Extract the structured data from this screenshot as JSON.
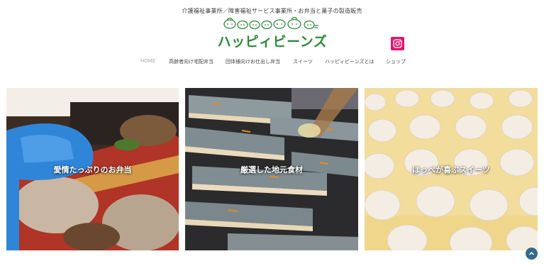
{
  "header": {
    "tagline": "介護福祉事業所／障害福祉サービス事業所・お弁当と菓子の製造販売",
    "logo_text": "ハッピィビーンズ",
    "instagram_icon": "instagram-icon",
    "instagram_color": "#e4156e",
    "logo_color": "#2e8a3a"
  },
  "nav": {
    "items": [
      {
        "label": "HOME",
        "active": true
      },
      {
        "label": "高齢者向け宅配弁当"
      },
      {
        "label": "団体様向けお仕出し弁当"
      },
      {
        "label": "スイーツ"
      },
      {
        "label": "ハッピィビーンズとは"
      },
      {
        "label": "ショップ"
      }
    ]
  },
  "panels": [
    {
      "label": "愛情たっぷりのお弁当",
      "image": "bento-photo"
    },
    {
      "label": "厳選した地元食材",
      "image": "grilled-fish-photo"
    },
    {
      "label": "ほっぺが喜ぶスイーツ",
      "image": "sweets-photo"
    }
  ],
  "scroll_top": {
    "icon": "chevron-up-icon",
    "color": "#356b8c"
  }
}
